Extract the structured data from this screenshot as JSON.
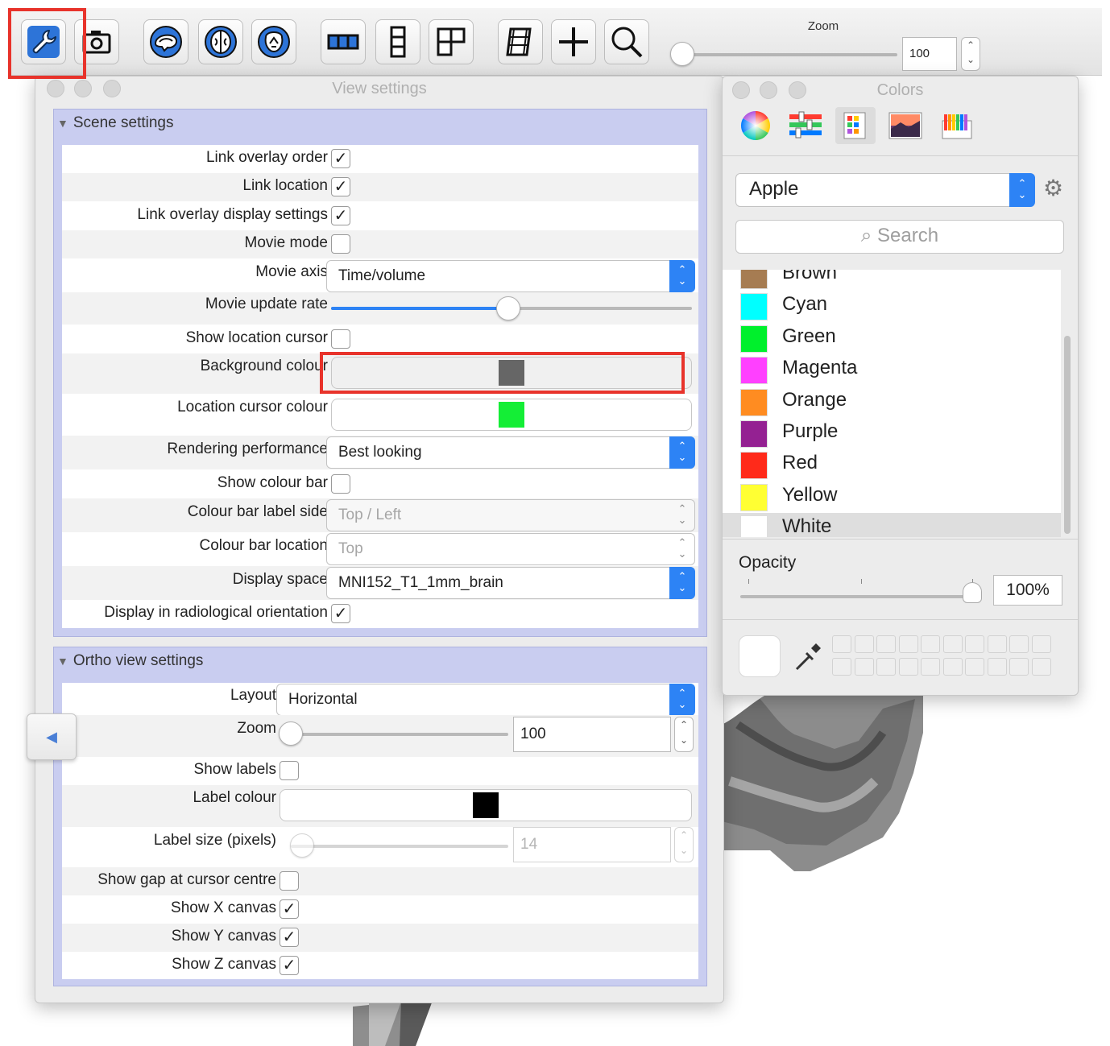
{
  "toolbar": {
    "buttons": [
      {
        "name": "settings-wrench",
        "icon": "wrench-icon"
      },
      {
        "name": "screenshot",
        "icon": "camera-icon"
      },
      {
        "name": "ortho-view",
        "icon": "brain-sagittal-icon"
      },
      {
        "name": "lightbox-view",
        "icon": "brain-axial-icon"
      },
      {
        "name": "3d-view",
        "icon": "brain-coronal-icon"
      },
      {
        "name": "layout-horizontal",
        "icon": "layout-horizontal-icon"
      },
      {
        "name": "layout-vertical",
        "icon": "layout-vertical-icon"
      },
      {
        "name": "layout-grid",
        "icon": "layout-grid-icon"
      },
      {
        "name": "movie-mode",
        "icon": "film-icon"
      },
      {
        "name": "toggle-cursor",
        "icon": "crosshair-icon"
      },
      {
        "name": "reset-zoom",
        "icon": "magnifier-icon"
      }
    ],
    "zoom_label": "Zoom",
    "zoom_value": "100",
    "zoom_slider_fraction": 0.0
  },
  "view_settings": {
    "title": "View settings",
    "scene_settings": {
      "header": "Scene settings",
      "link_overlay_order": {
        "label": "Link overlay order",
        "checked": true
      },
      "link_location": {
        "label": "Link location",
        "checked": true
      },
      "link_overlay_display": {
        "label": "Link overlay display settings",
        "checked": true
      },
      "movie_mode": {
        "label": "Movie mode",
        "checked": false
      },
      "movie_axis": {
        "label": "Movie axis",
        "value": "Time/volume"
      },
      "movie_update_rate": {
        "label": "Movie update rate",
        "fraction": 0.49
      },
      "show_location_cursor": {
        "label": "Show location cursor",
        "checked": false
      },
      "background_colour": {
        "label": "Background colour",
        "color": "#666666"
      },
      "location_cursor_colour": {
        "label": "Location cursor colour",
        "color": "#14ee36"
      },
      "rendering_performance": {
        "label": "Rendering performance",
        "value": "Best looking"
      },
      "show_colour_bar": {
        "label": "Show colour bar",
        "checked": false
      },
      "colour_bar_label_side": {
        "label": "Colour bar label side",
        "value": "Top / Left"
      },
      "colour_bar_location": {
        "label": "Colour bar location",
        "value": "Top"
      },
      "display_space": {
        "label": "Display space",
        "value": "MNI152_T1_1mm_brain"
      },
      "radiological": {
        "label": "Display in radiological orientation",
        "checked": true
      }
    },
    "ortho_settings": {
      "header": "Ortho view settings",
      "layout": {
        "label": "Layout",
        "value": "Horizontal"
      },
      "zoom": {
        "label": "Zoom",
        "value": "100",
        "fraction": 0.0
      },
      "show_labels": {
        "label": "Show labels",
        "checked": false
      },
      "label_colour": {
        "label": "Label colour",
        "color": "#000000"
      },
      "label_size": {
        "label": "Label size (pixels)",
        "value": "14",
        "fraction": 0.05
      },
      "show_gap": {
        "label": "Show gap at cursor centre",
        "checked": false
      },
      "show_x": {
        "label": "Show X canvas",
        "checked": true
      },
      "show_y": {
        "label": "Show Y canvas",
        "checked": true
      },
      "show_z": {
        "label": "Show Z canvas",
        "checked": true
      }
    }
  },
  "colors_panel": {
    "title": "Colors",
    "modes": [
      "color-wheel-icon",
      "color-sliders-icon",
      "color-palettes-icon",
      "image-palettes-icon",
      "crayons-icon"
    ],
    "palette": "Apple",
    "search_placeholder": "Search",
    "list": [
      {
        "name": "Brown",
        "color": "#a67c52"
      },
      {
        "name": "Cyan",
        "color": "#00ffff"
      },
      {
        "name": "Green",
        "color": "#00f02c"
      },
      {
        "name": "Magenta",
        "color": "#ff40ff"
      },
      {
        "name": "Orange",
        "color": "#ff8c21"
      },
      {
        "name": "Purple",
        "color": "#942192"
      },
      {
        "name": "Red",
        "color": "#ff2a1a"
      },
      {
        "name": "Yellow",
        "color": "#ffff33"
      },
      {
        "name": "White",
        "color": "#ffffff",
        "selected": true
      }
    ],
    "opacity_label": "Opacity",
    "opacity_value": "100%",
    "opacity_fraction": 1.0
  },
  "accent": "#2d83f5",
  "highlight": "#e8332b"
}
